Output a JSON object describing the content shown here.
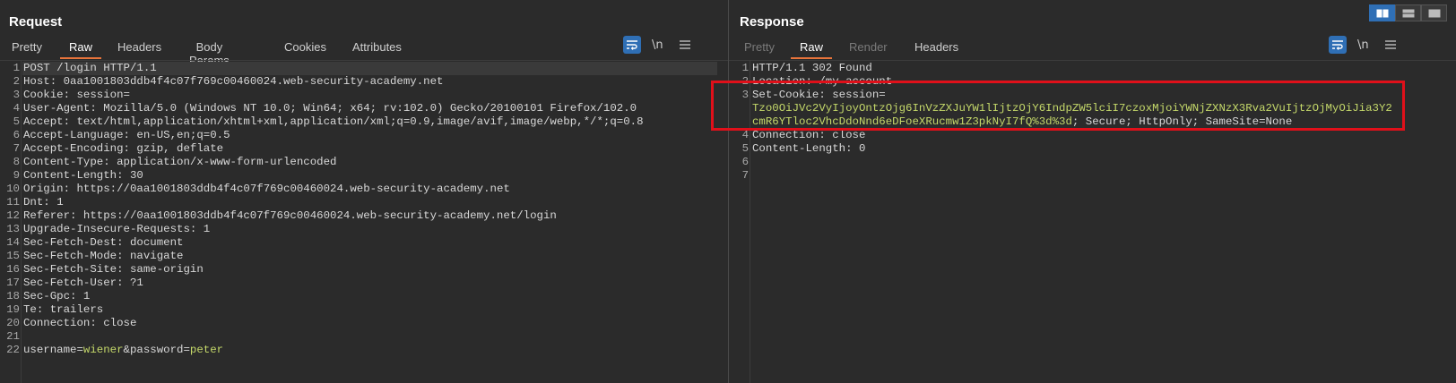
{
  "request": {
    "title": "Request",
    "tabs": [
      "Pretty",
      "Raw",
      "Headers",
      "Body Params",
      "Cookies",
      "Attributes"
    ],
    "active_tab": "Raw",
    "tools": {
      "newline_label": "\\n"
    },
    "lines": [
      {
        "n": "1",
        "parts": [
          [
            "POST /login HTTP/1.1",
            ""
          ]
        ]
      },
      {
        "n": "2",
        "parts": [
          [
            "Host: ",
            ""
          ],
          [
            "0aa1001803ddb4f4c07f769c00460024.web-security-academy.net",
            ""
          ]
        ]
      },
      {
        "n": "3",
        "parts": [
          [
            "Cookie: ",
            ""
          ],
          [
            "session=",
            ""
          ]
        ]
      },
      {
        "n": "4",
        "parts": [
          [
            "User-Agent: ",
            ""
          ],
          [
            "Mozilla/5.0 (Windows NT 10.0; Win64; x64; rv:102.0) Gecko/20100101 Firefox/102.0",
            ""
          ]
        ]
      },
      {
        "n": "5",
        "parts": [
          [
            "Accept: ",
            ""
          ],
          [
            "text/html,application/xhtml+xml,application/xml;q=0.9,image/avif,image/webp,*/*;q=0.8",
            ""
          ]
        ]
      },
      {
        "n": "6",
        "parts": [
          [
            "Accept-Language: ",
            ""
          ],
          [
            "en-US,en;q=0.5",
            ""
          ]
        ]
      },
      {
        "n": "7",
        "parts": [
          [
            "Accept-Encoding: ",
            ""
          ],
          [
            "gzip, deflate",
            ""
          ]
        ]
      },
      {
        "n": "8",
        "parts": [
          [
            "Content-Type: ",
            ""
          ],
          [
            "application/x-www-form-urlencoded",
            ""
          ]
        ]
      },
      {
        "n": "9",
        "parts": [
          [
            "Content-Length: ",
            ""
          ],
          [
            "30",
            ""
          ]
        ]
      },
      {
        "n": "10",
        "parts": [
          [
            "Origin: ",
            ""
          ],
          [
            "https://0aa1001803ddb4f4c07f769c00460024.web-security-academy.net",
            ""
          ]
        ]
      },
      {
        "n": "11",
        "parts": [
          [
            "Dnt: ",
            ""
          ],
          [
            "1",
            ""
          ]
        ]
      },
      {
        "n": "12",
        "parts": [
          [
            "Referer: ",
            ""
          ],
          [
            "https://0aa1001803ddb4f4c07f769c00460024.web-security-academy.net/login",
            ""
          ]
        ]
      },
      {
        "n": "13",
        "parts": [
          [
            "Upgrade-Insecure-Requests: ",
            ""
          ],
          [
            "1",
            ""
          ]
        ]
      },
      {
        "n": "14",
        "parts": [
          [
            "Sec-Fetch-Dest: ",
            ""
          ],
          [
            "document",
            ""
          ]
        ]
      },
      {
        "n": "15",
        "parts": [
          [
            "Sec-Fetch-Mode: ",
            ""
          ],
          [
            "navigate",
            ""
          ]
        ]
      },
      {
        "n": "16",
        "parts": [
          [
            "Sec-Fetch-Site: ",
            ""
          ],
          [
            "same-origin",
            ""
          ]
        ]
      },
      {
        "n": "17",
        "parts": [
          [
            "Sec-Fetch-User: ",
            ""
          ],
          [
            "?1",
            ""
          ]
        ]
      },
      {
        "n": "18",
        "parts": [
          [
            "Sec-Gpc: ",
            ""
          ],
          [
            "1",
            ""
          ]
        ]
      },
      {
        "n": "19",
        "parts": [
          [
            "Te: ",
            ""
          ],
          [
            "trailers",
            ""
          ]
        ]
      },
      {
        "n": "20",
        "parts": [
          [
            "Connection: ",
            ""
          ],
          [
            "close",
            ""
          ]
        ]
      },
      {
        "n": "21",
        "parts": []
      },
      {
        "n": "22",
        "parts": [
          [
            "username=",
            ""
          ],
          [
            "wiener",
            "green"
          ],
          [
            "&password=",
            ""
          ],
          [
            "peter",
            "green"
          ]
        ]
      }
    ]
  },
  "response": {
    "title": "Response",
    "tabs": [
      "Pretty",
      "Raw",
      "Render",
      "Headers"
    ],
    "disabled_tabs": [
      "Pretty",
      "Render"
    ],
    "active_tab": "Raw",
    "tools": {
      "newline_label": "\\n"
    },
    "lines": [
      {
        "n": "1",
        "parts": [
          [
            "HTTP/1.1 302 Found",
            ""
          ]
        ]
      },
      {
        "n": "2",
        "parts": [
          [
            "Location: ",
            ""
          ],
          [
            "/my-account",
            ""
          ]
        ]
      },
      {
        "n": "3",
        "parts": [
          [
            "Set-Cookie: ",
            ""
          ],
          [
            "session=",
            ""
          ]
        ]
      },
      {
        "n": "",
        "parts": [
          [
            "Tzo0OiJVc2VyIjoyOntzOjg6InVzZXJuYW1lIjtzOjY6IndpZW5lciI7czoxMjoiYWNjZXNzX3Rva2VuIjtzOjMyOiJia3Y2",
            "green"
          ]
        ]
      },
      {
        "n": "",
        "parts": [
          [
            "cmR6YTloc2VhcDdoNnd6eDFoeXRucmw1Z3pkNyI7fQ%3d%3d",
            "green"
          ],
          [
            "; Secure; HttpOnly; SameSite=None",
            ""
          ]
        ]
      },
      {
        "n": "4",
        "parts": [
          [
            "Connection: ",
            ""
          ],
          [
            "close",
            ""
          ]
        ]
      },
      {
        "n": "5",
        "parts": [
          [
            "Content-Length: ",
            ""
          ],
          [
            "0",
            ""
          ]
        ]
      },
      {
        "n": "6",
        "parts": []
      },
      {
        "n": "7",
        "parts": []
      }
    ]
  },
  "colors": {
    "accent_tab": "#e8743b",
    "highlight_box": "#e0101a",
    "tool_active": "#2f6fb5",
    "value_green": "#c5d96a"
  }
}
